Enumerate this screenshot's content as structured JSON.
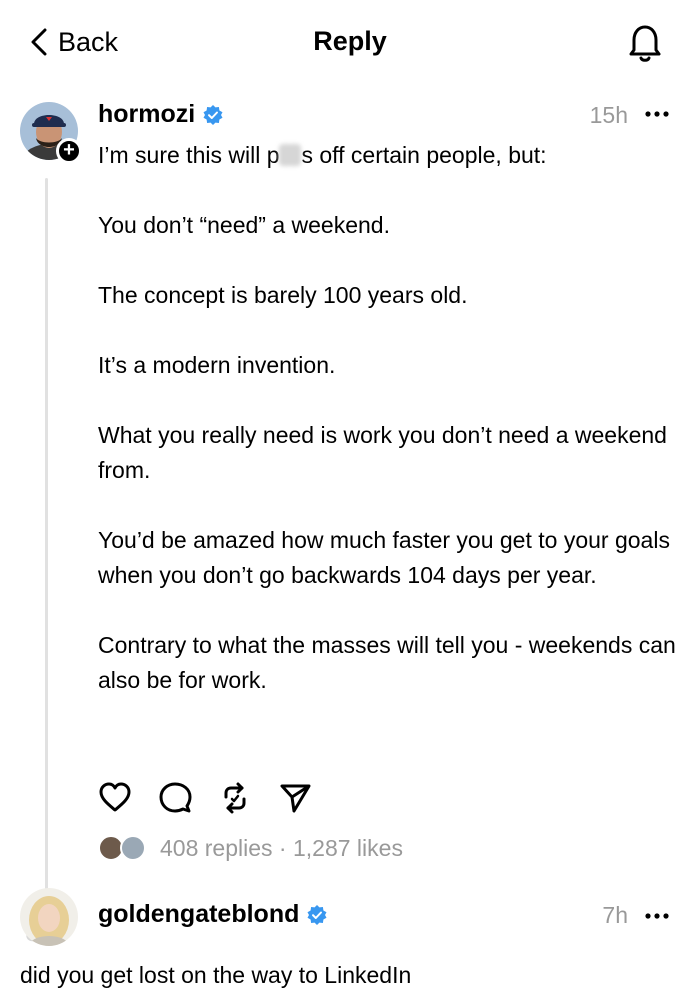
{
  "header": {
    "back_label": "Back",
    "title": "Reply",
    "back_icon": "chevron-left-icon",
    "bell_icon": "bell-icon"
  },
  "post": {
    "username": "hormozi",
    "time": "15h",
    "line1_before": "I’m sure this will p",
    "line1_after": "s off certain people, but:",
    "paragraphs": [
      "You don’t “need” a weekend.",
      "The concept is barely 100 years old.",
      "It’s a modern invention.",
      "What you really need is work you don’t need a weekend from.",
      "You’d be amazed how much faster you get to your goals when you don’t go backwards 104 days per year.",
      "Contrary to what the masses will tell you - weekends can also be for work."
    ],
    "replies_count": "408 replies",
    "separator": " · ",
    "likes_count": "1,287 likes"
  },
  "reply": {
    "username": "goldengateblond",
    "time": "7h",
    "text": "did you get lost on the way to LinkedIn"
  },
  "colors": {
    "verified": "#3897f0",
    "muted": "#999999",
    "thread_line": "#e1e1e1"
  }
}
